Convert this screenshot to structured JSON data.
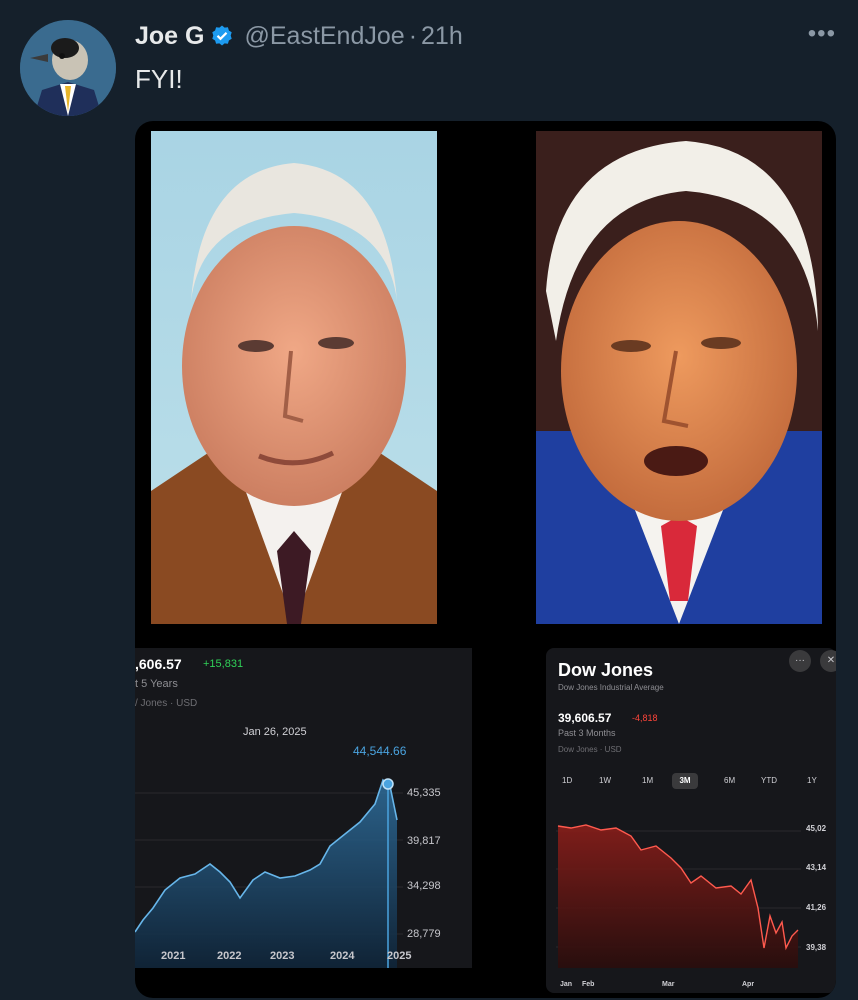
{
  "tweet": {
    "author_name": "Joe G",
    "handle": "@EastEndJoe",
    "separator": "·",
    "time": "21h",
    "text": "FYI!",
    "more_icon": "ellipsis-icon",
    "verified_icon": "verified-badge-icon"
  },
  "left_chart": {
    "value_partial": ",606.57",
    "change": "+15,831",
    "period_partial": "t 5 Years",
    "source_partial": "/ Jones · USD",
    "tooltip_date": "Jan 26, 2025",
    "tooltip_value": "44,544.66",
    "y_ticks": [
      "45,335",
      "39,817",
      "34,298",
      "28,779"
    ],
    "x_ticks": [
      "2021",
      "2022",
      "2023",
      "2024",
      "2025"
    ]
  },
  "right_chart": {
    "title": "Dow Jones",
    "subtitle": "Dow Jones Industrial Average",
    "value": "39,606.57",
    "change": "-4,818",
    "period": "Past 3 Months",
    "source": "Dow Jones · USD",
    "ranges": [
      "1D",
      "1W",
      "1M",
      "3M",
      "6M",
      "YTD",
      "1Y"
    ],
    "selected_range": "3M",
    "y_ticks": [
      "45,02",
      "43,14",
      "41,26",
      "39,38"
    ],
    "x_ticks": [
      "Jan",
      "Feb",
      "Mar",
      "Apr"
    ],
    "more_button": "···",
    "close_button": "✕"
  },
  "colors": {
    "background": "#15202b",
    "positive": "#30d158",
    "negative": "#ff453a",
    "chart_blue": "#4aa3df",
    "verified": "#1d9bf0"
  },
  "chart_data": [
    {
      "type": "area",
      "title": "",
      "x": [
        "2021",
        "2022",
        "2023",
        "2024",
        "2025"
      ],
      "series": [
        {
          "values": [
            30000,
            36000,
            33500,
            37500,
            42500,
            44544.66
          ]
        }
      ],
      "y_ticks": [
        45335,
        39817,
        34298,
        28779
      ],
      "annotation": {
        "date": "Jan 26, 2025",
        "value": 44544.66
      }
    },
    {
      "type": "area",
      "title": "Dow Jones",
      "x": [
        "Jan",
        "Feb",
        "Mar",
        "Apr"
      ],
      "series": [
        {
          "values": [
            44800,
            44500,
            43500,
            42000,
            41500,
            39606.57
          ]
        }
      ],
      "y_ticks": [
        45020,
        43140,
        41260,
        39380
      ]
    }
  ]
}
